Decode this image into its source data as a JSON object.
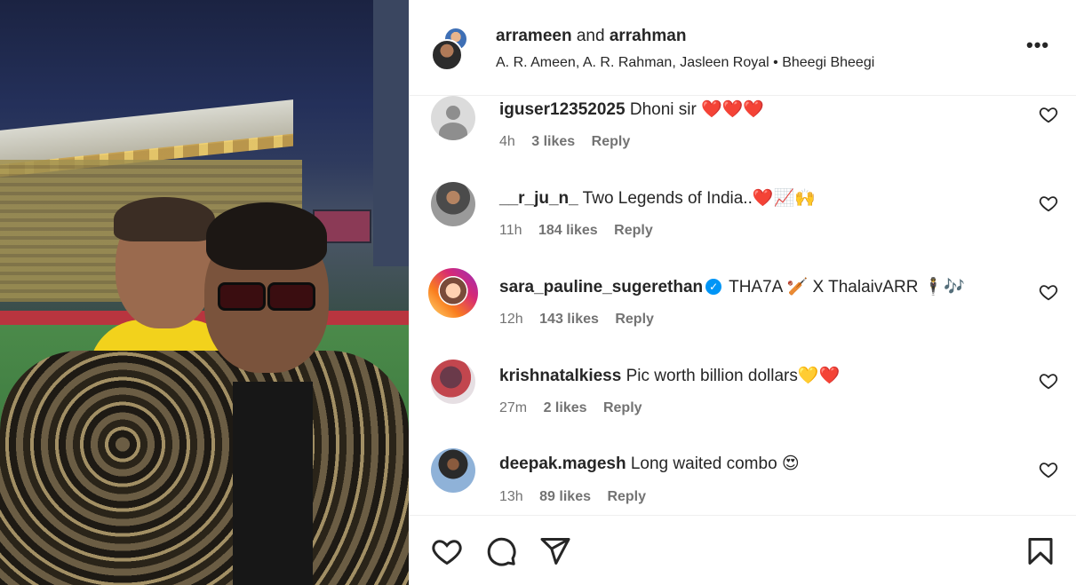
{
  "post": {
    "owner_primary": "arrameen",
    "owner_joiner": "and",
    "owner_secondary": "arrahman",
    "audio_line": "A. R. Ameen, A. R. Rahman, Jasleen Royal • Bheegi Bheegi",
    "more_label": "•••"
  },
  "comments": [
    {
      "user": "iguser12352025",
      "text": "Dhoni sir ❤️❤️❤️",
      "time": "4h",
      "likes": "3 likes",
      "reply": "Reply",
      "avatar": "default-avatar-icon"
    },
    {
      "user": "__r_ju_n_",
      "text": "Two Legends of India..❤️📈🙌",
      "time": "11h",
      "likes": "184 likes",
      "reply": "Reply",
      "avatar": "photo"
    },
    {
      "user": "sara_pauline_sugerethan",
      "text": "THA7A 🏏 X ThalaivARR 🕴️🎶",
      "time": "12h",
      "likes": "143 likes",
      "reply": "Reply",
      "avatar": "story-ring-photo",
      "verified": true
    },
    {
      "user": "krishnatalkiess",
      "text": "Pic worth billion dollars💛❤️",
      "time": "27m",
      "likes": "2 likes",
      "reply": "Reply",
      "avatar": "photo"
    },
    {
      "user": "deepak.magesh",
      "text": "Long waited combo 😍",
      "time": "13h",
      "likes": "89 likes",
      "reply": "Reply",
      "avatar": "photo"
    }
  ],
  "actions": [
    "like-icon",
    "comment-icon",
    "share-icon",
    "save-icon"
  ],
  "colors": {
    "text": "#262626",
    "meta": "#737373",
    "verified": "#0095f6",
    "border": "#efefef"
  }
}
